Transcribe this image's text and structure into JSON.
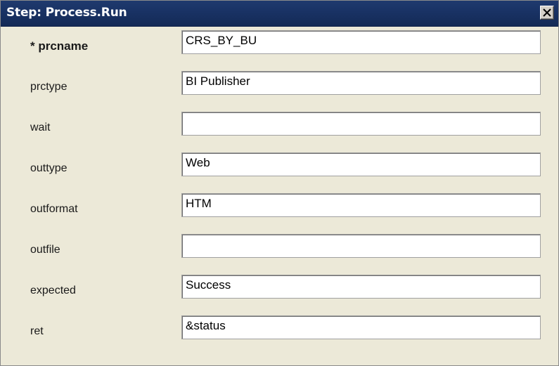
{
  "window": {
    "title": "Step: Process.Run",
    "close_icon": "close-icon"
  },
  "fields": [
    {
      "label": "* prcname",
      "value": "CRS_BY_BU",
      "required": true
    },
    {
      "label": "prctype",
      "value": "BI Publisher",
      "required": false
    },
    {
      "label": "wait",
      "value": "",
      "required": false
    },
    {
      "label": "outtype",
      "value": "Web",
      "required": false
    },
    {
      "label": "outformat",
      "value": "HTM",
      "required": false
    },
    {
      "label": "outfile",
      "value": "",
      "required": false
    },
    {
      "label": "expected",
      "value": "Success",
      "required": false
    },
    {
      "label": "ret",
      "value": "&status",
      "required": false
    }
  ],
  "colors": {
    "titlebar": "#193264",
    "background": "#ece9d8",
    "title_text": "#ffffff"
  }
}
